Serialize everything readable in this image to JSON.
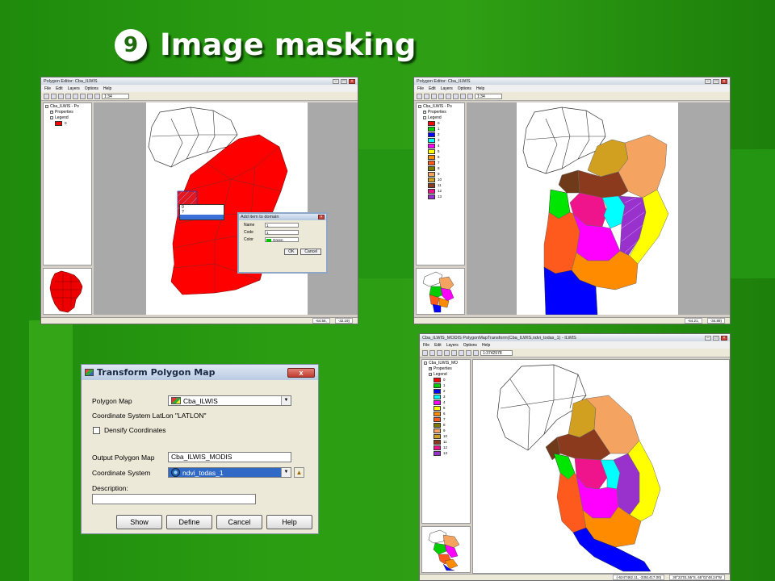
{
  "slide": {
    "number_badge": "9",
    "title": "Image masking"
  },
  "win1": {
    "title": "Polygon Editor: Cba_ILWIS",
    "menu": [
      "File",
      "Edit",
      "Layers",
      "Options",
      "Help"
    ],
    "scale": "1:34",
    "tree": {
      "root": "Cba_ILWIS - Po",
      "properties": "Properties",
      "legend": "Legend",
      "legend_item": "0"
    },
    "popup_items": [
      "0",
      "?",
      ""
    ],
    "dialog": {
      "title": "Add item to domain",
      "name_label": "Name",
      "name_value": "1",
      "code_label": "Code",
      "code_value": "1",
      "color_label": "Color",
      "color_value": "Green",
      "ok": "OK",
      "cancel": "Cancel"
    },
    "status": [
      "-64.56,",
      "-32.19)"
    ]
  },
  "win2": {
    "title": "Polygon Editor: Cba_ILWIS",
    "menu": [
      "File",
      "Edit",
      "Layers",
      "Options",
      "Help"
    ],
    "scale": "1:34",
    "tree": {
      "root": "Cba_ILWIS - Po",
      "properties": "Properties",
      "legend": "Legend"
    },
    "legend": [
      {
        "label": "0",
        "color": "#ff0000"
      },
      {
        "label": "1",
        "color": "#00cc00"
      },
      {
        "label": "2",
        "color": "#0000ff"
      },
      {
        "label": "3",
        "color": "#00ffff"
      },
      {
        "label": "4",
        "color": "#ff00ff"
      },
      {
        "label": "5",
        "color": "#ffff00"
      },
      {
        "label": "6",
        "color": "#ff8c00"
      },
      {
        "label": "7",
        "color": "#ff5a1e"
      },
      {
        "label": "8",
        "color": "#7a7a00"
      },
      {
        "label": "9",
        "color": "#f4a460"
      },
      {
        "label": "10",
        "color": "#d2a020"
      },
      {
        "label": "11",
        "color": "#8b3a1e"
      },
      {
        "label": "12",
        "color": "#f0148c"
      },
      {
        "label": "13",
        "color": "#9932cc"
      }
    ],
    "status": [
      "-64.21,",
      "-34.89)"
    ]
  },
  "dialog": {
    "title": "Transform Polygon Map",
    "polygon_map_label": "Polygon Map",
    "polygon_map_value": "Cba_ILWIS",
    "coord_sys_info": "Coordinate System LatLon \"LATLON\"",
    "densify_label": "Densify Coordinates",
    "output_label": "Output Polygon Map",
    "output_value": "Cba_ILWIS_MODIS",
    "coord_sys_label": "Coordinate System",
    "coord_sys_value": "ndvi_todas_1",
    "description_label": "Description:",
    "description_value": "",
    "buttons": [
      "Show",
      "Define",
      "Cancel",
      "Help"
    ]
  },
  "win3": {
    "title": "Cba_ILWIS_MODIS PolygonMapTransform(Cba_ILWIS,ndvi_todas_1) - ILWIS",
    "menu": [
      "File",
      "Edit",
      "Layers",
      "Options",
      "Help"
    ],
    "scale": "1:3742978",
    "tree": {
      "root": "Cba_ILWIS_MO",
      "properties": "Properties",
      "legend": "Legend"
    },
    "legend_labels": [
      "0",
      "1",
      "2",
      "3",
      "4",
      "5",
      "6",
      "7",
      "8",
      "9",
      "10",
      "11",
      "12",
      "13"
    ],
    "status": [
      "(-6247462.11, -3351417.00)",
      "30°22'01.55\"S, 65°02'48.24\"W"
    ]
  }
}
